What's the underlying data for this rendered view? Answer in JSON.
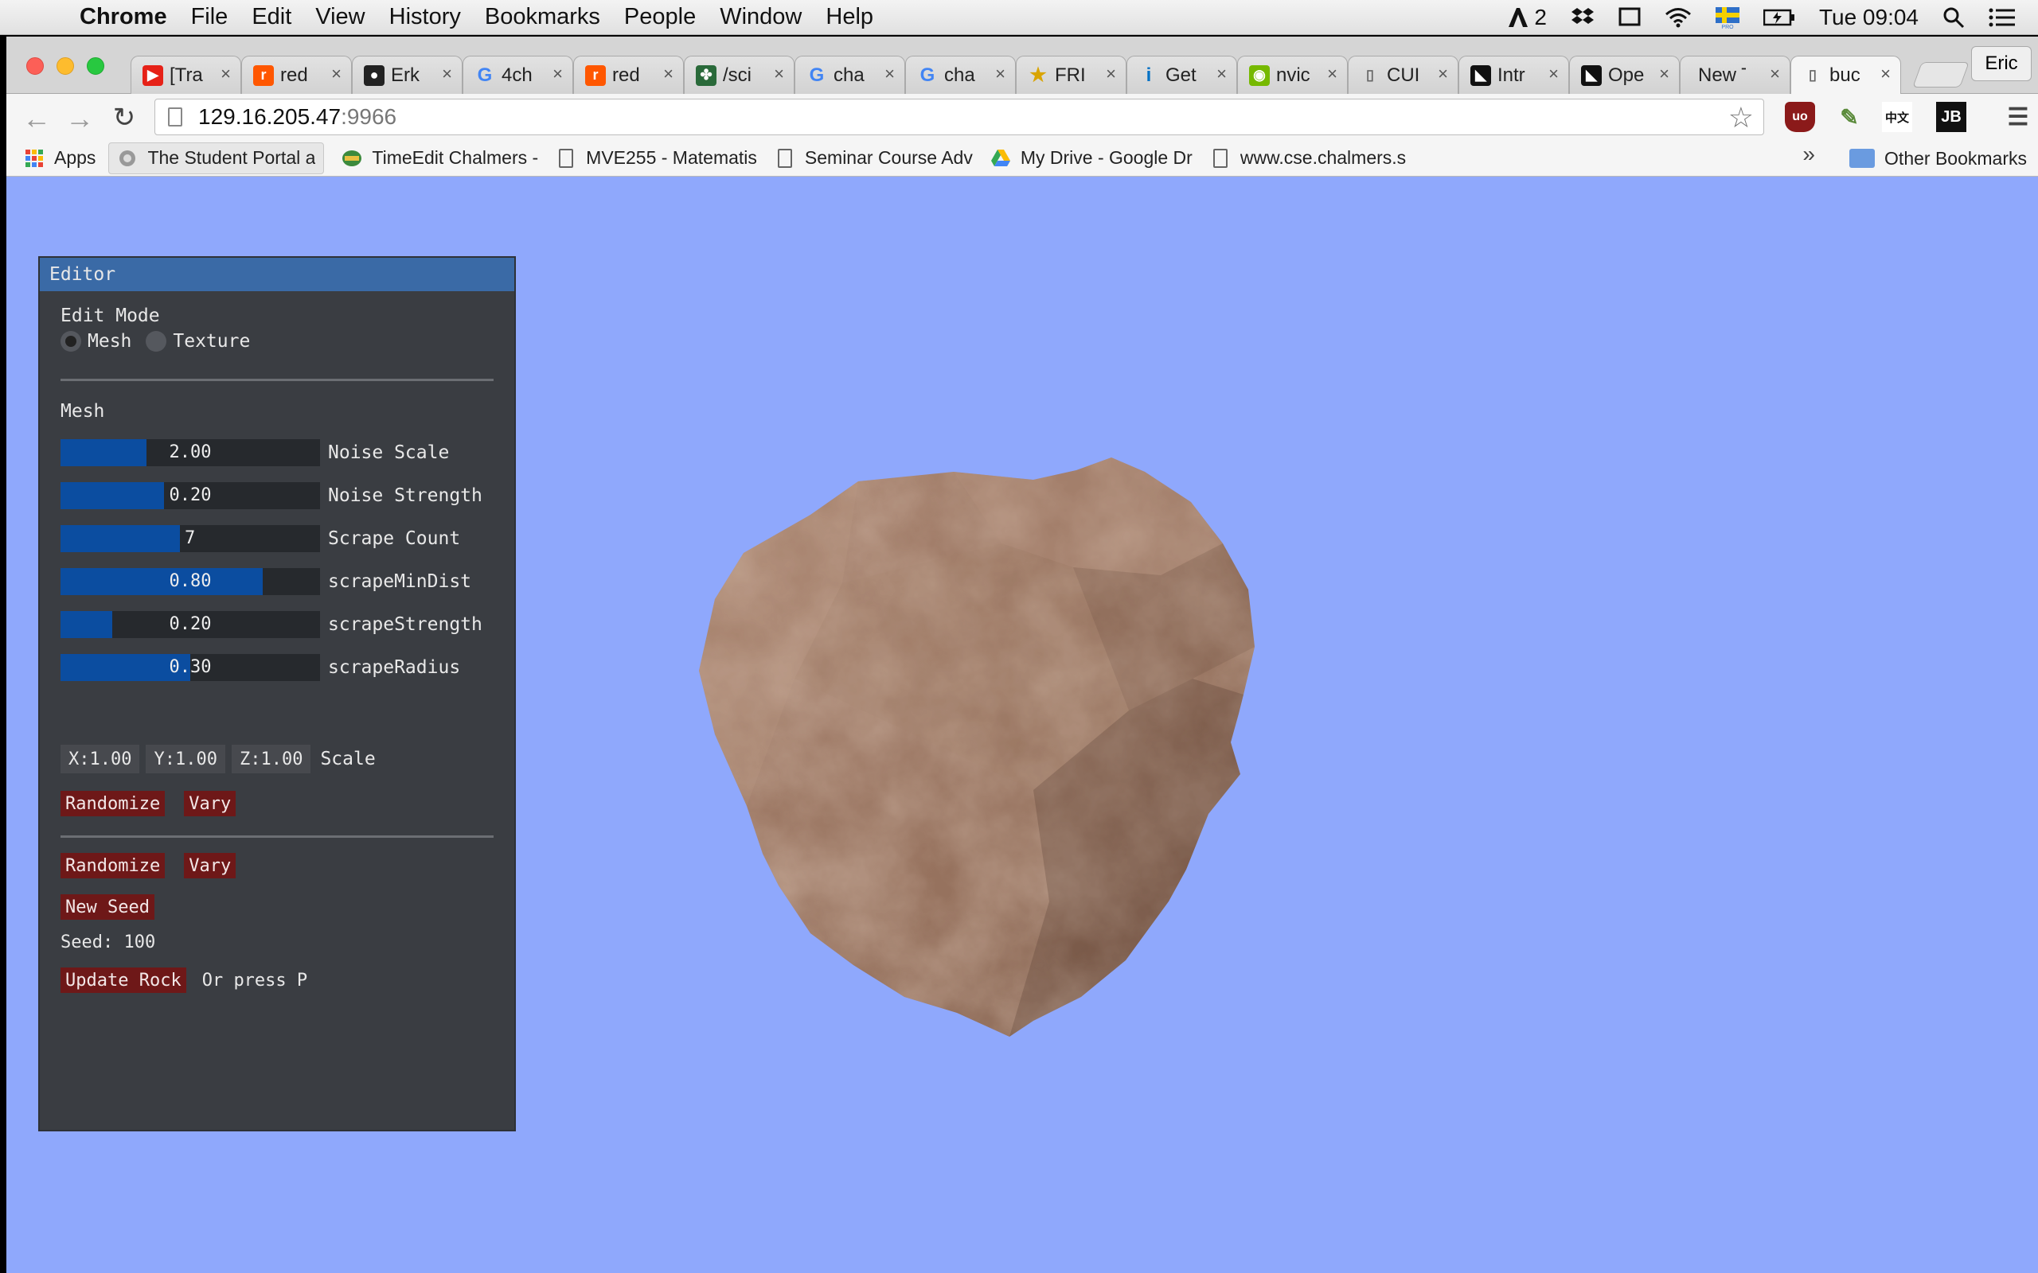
{
  "menubar": {
    "app_name": "Chrome",
    "menus": [
      "File",
      "Edit",
      "View",
      "History",
      "Bookmarks",
      "People",
      "Window",
      "Help"
    ],
    "status_count": "2",
    "clock": "Tue 09:04"
  },
  "tabs": [
    {
      "label": "[Tra",
      "icon": "youtube-icon",
      "color": "#e62117",
      "glyph": "▶"
    },
    {
      "label": "red",
      "icon": "reddit-icon",
      "color": "#ff5700",
      "glyph": "r"
    },
    {
      "label": "Erk",
      "icon": "github-icon",
      "color": "#222222",
      "glyph": "●"
    },
    {
      "label": "4ch",
      "icon": "google-icon",
      "color": "#4285f4",
      "glyph": "G"
    },
    {
      "label": "red",
      "icon": "reddit-icon",
      "color": "#ff5700",
      "glyph": "r"
    },
    {
      "label": "/sci",
      "icon": "clover-icon",
      "color": "#2a6a3a",
      "glyph": "✤"
    },
    {
      "label": "cha",
      "icon": "google-icon",
      "color": "#4285f4",
      "glyph": "G"
    },
    {
      "label": "cha",
      "icon": "google-icon",
      "color": "#4285f4",
      "glyph": "G"
    },
    {
      "label": "FRI",
      "icon": "star-icon",
      "color": "#d9a400",
      "glyph": "★"
    },
    {
      "label": "Get",
      "icon": "intel-icon",
      "color": "#0071c5",
      "glyph": "i"
    },
    {
      "label": "nvic",
      "icon": "nvidia-icon",
      "color": "#76b900",
      "glyph": "◉"
    },
    {
      "label": "CUI",
      "icon": "document-icon",
      "color": "#888888",
      "glyph": "▯"
    },
    {
      "label": "Intr",
      "icon": "amd-icon",
      "color": "#111111",
      "glyph": "◣"
    },
    {
      "label": "Ope",
      "icon": "amd-icon",
      "color": "#111111",
      "glyph": "◣"
    },
    {
      "label": "New T",
      "icon": "none",
      "color": "transparent",
      "glyph": ""
    },
    {
      "label": "buc",
      "icon": "document-icon",
      "color": "#888888",
      "glyph": "▯"
    }
  ],
  "profile_name": "Eric",
  "address_bar": {
    "host": "129.16.205.47",
    "port": ":9966"
  },
  "extensions": [
    {
      "name": "ublock-icon",
      "glyph": "uo",
      "color": "#8b1a1a"
    },
    {
      "name": "eyedropper-icon",
      "glyph": "✎",
      "color": "#5a8a3a"
    },
    {
      "name": "chinese-dict-icon",
      "glyph": "中文",
      "color": "#ffffff"
    },
    {
      "name": "jetbrains-icon",
      "glyph": "JB",
      "color": "#111111"
    }
  ],
  "bookmarks": [
    {
      "label": "Apps",
      "icon": "apps-icon"
    },
    {
      "label": "The Student Portal a",
      "icon": "chalmers-icon"
    },
    {
      "label": "TimeEdit Chalmers -",
      "icon": "timeedit-icon"
    },
    {
      "label": "MVE255 - Matematis",
      "icon": "document-icon"
    },
    {
      "label": "Seminar Course Adv",
      "icon": "document-icon"
    },
    {
      "label": "My Drive - Google Dr",
      "icon": "google-drive-icon"
    },
    {
      "label": "www.cse.chalmers.s",
      "icon": "document-icon"
    }
  ],
  "bookmarks_overflow": "»",
  "other_bookmarks": "Other Bookmarks",
  "editor": {
    "title": "Editor",
    "edit_mode_label": "Edit Mode",
    "modes": [
      {
        "label": "Mesh",
        "selected": true
      },
      {
        "label": "Texture",
        "selected": false
      }
    ],
    "mesh_header": "Mesh",
    "sliders": [
      {
        "label": "Noise Scale",
        "value": "2.00",
        "fill_fraction": 0.33
      },
      {
        "label": "Noise Strength",
        "value": "0.20",
        "fill_fraction": 0.4
      },
      {
        "label": "Scrape Count",
        "value": "7",
        "fill_fraction": 0.46
      },
      {
        "label": "scrapeMinDist",
        "value": "0.80",
        "fill_fraction": 0.78
      },
      {
        "label": "scrapeStrength",
        "value": "0.20",
        "fill_fraction": 0.2
      },
      {
        "label": "scrapeRadius",
        "value": "0.30",
        "fill_fraction": 0.5
      }
    ],
    "scale": {
      "x": "X:1.00",
      "y": "Y:1.00",
      "z": "Z:1.00",
      "label": "Scale"
    },
    "mesh_randomize": "Randomize",
    "mesh_vary": "Vary",
    "texture_randomize": "Randomize",
    "texture_vary": "Vary",
    "new_seed": "New Seed",
    "seed_text": "Seed: 100",
    "update_rock": "Update Rock",
    "update_hint": "Or press P"
  },
  "colors": {
    "viewport_bg": "#8fa8fc",
    "panel_bg": "#3a3d42",
    "title_bar": "#3a6aa6",
    "slider_fill": "#0b4da0",
    "button_bg": "#6e1818",
    "rock_base": "#9a7460"
  }
}
